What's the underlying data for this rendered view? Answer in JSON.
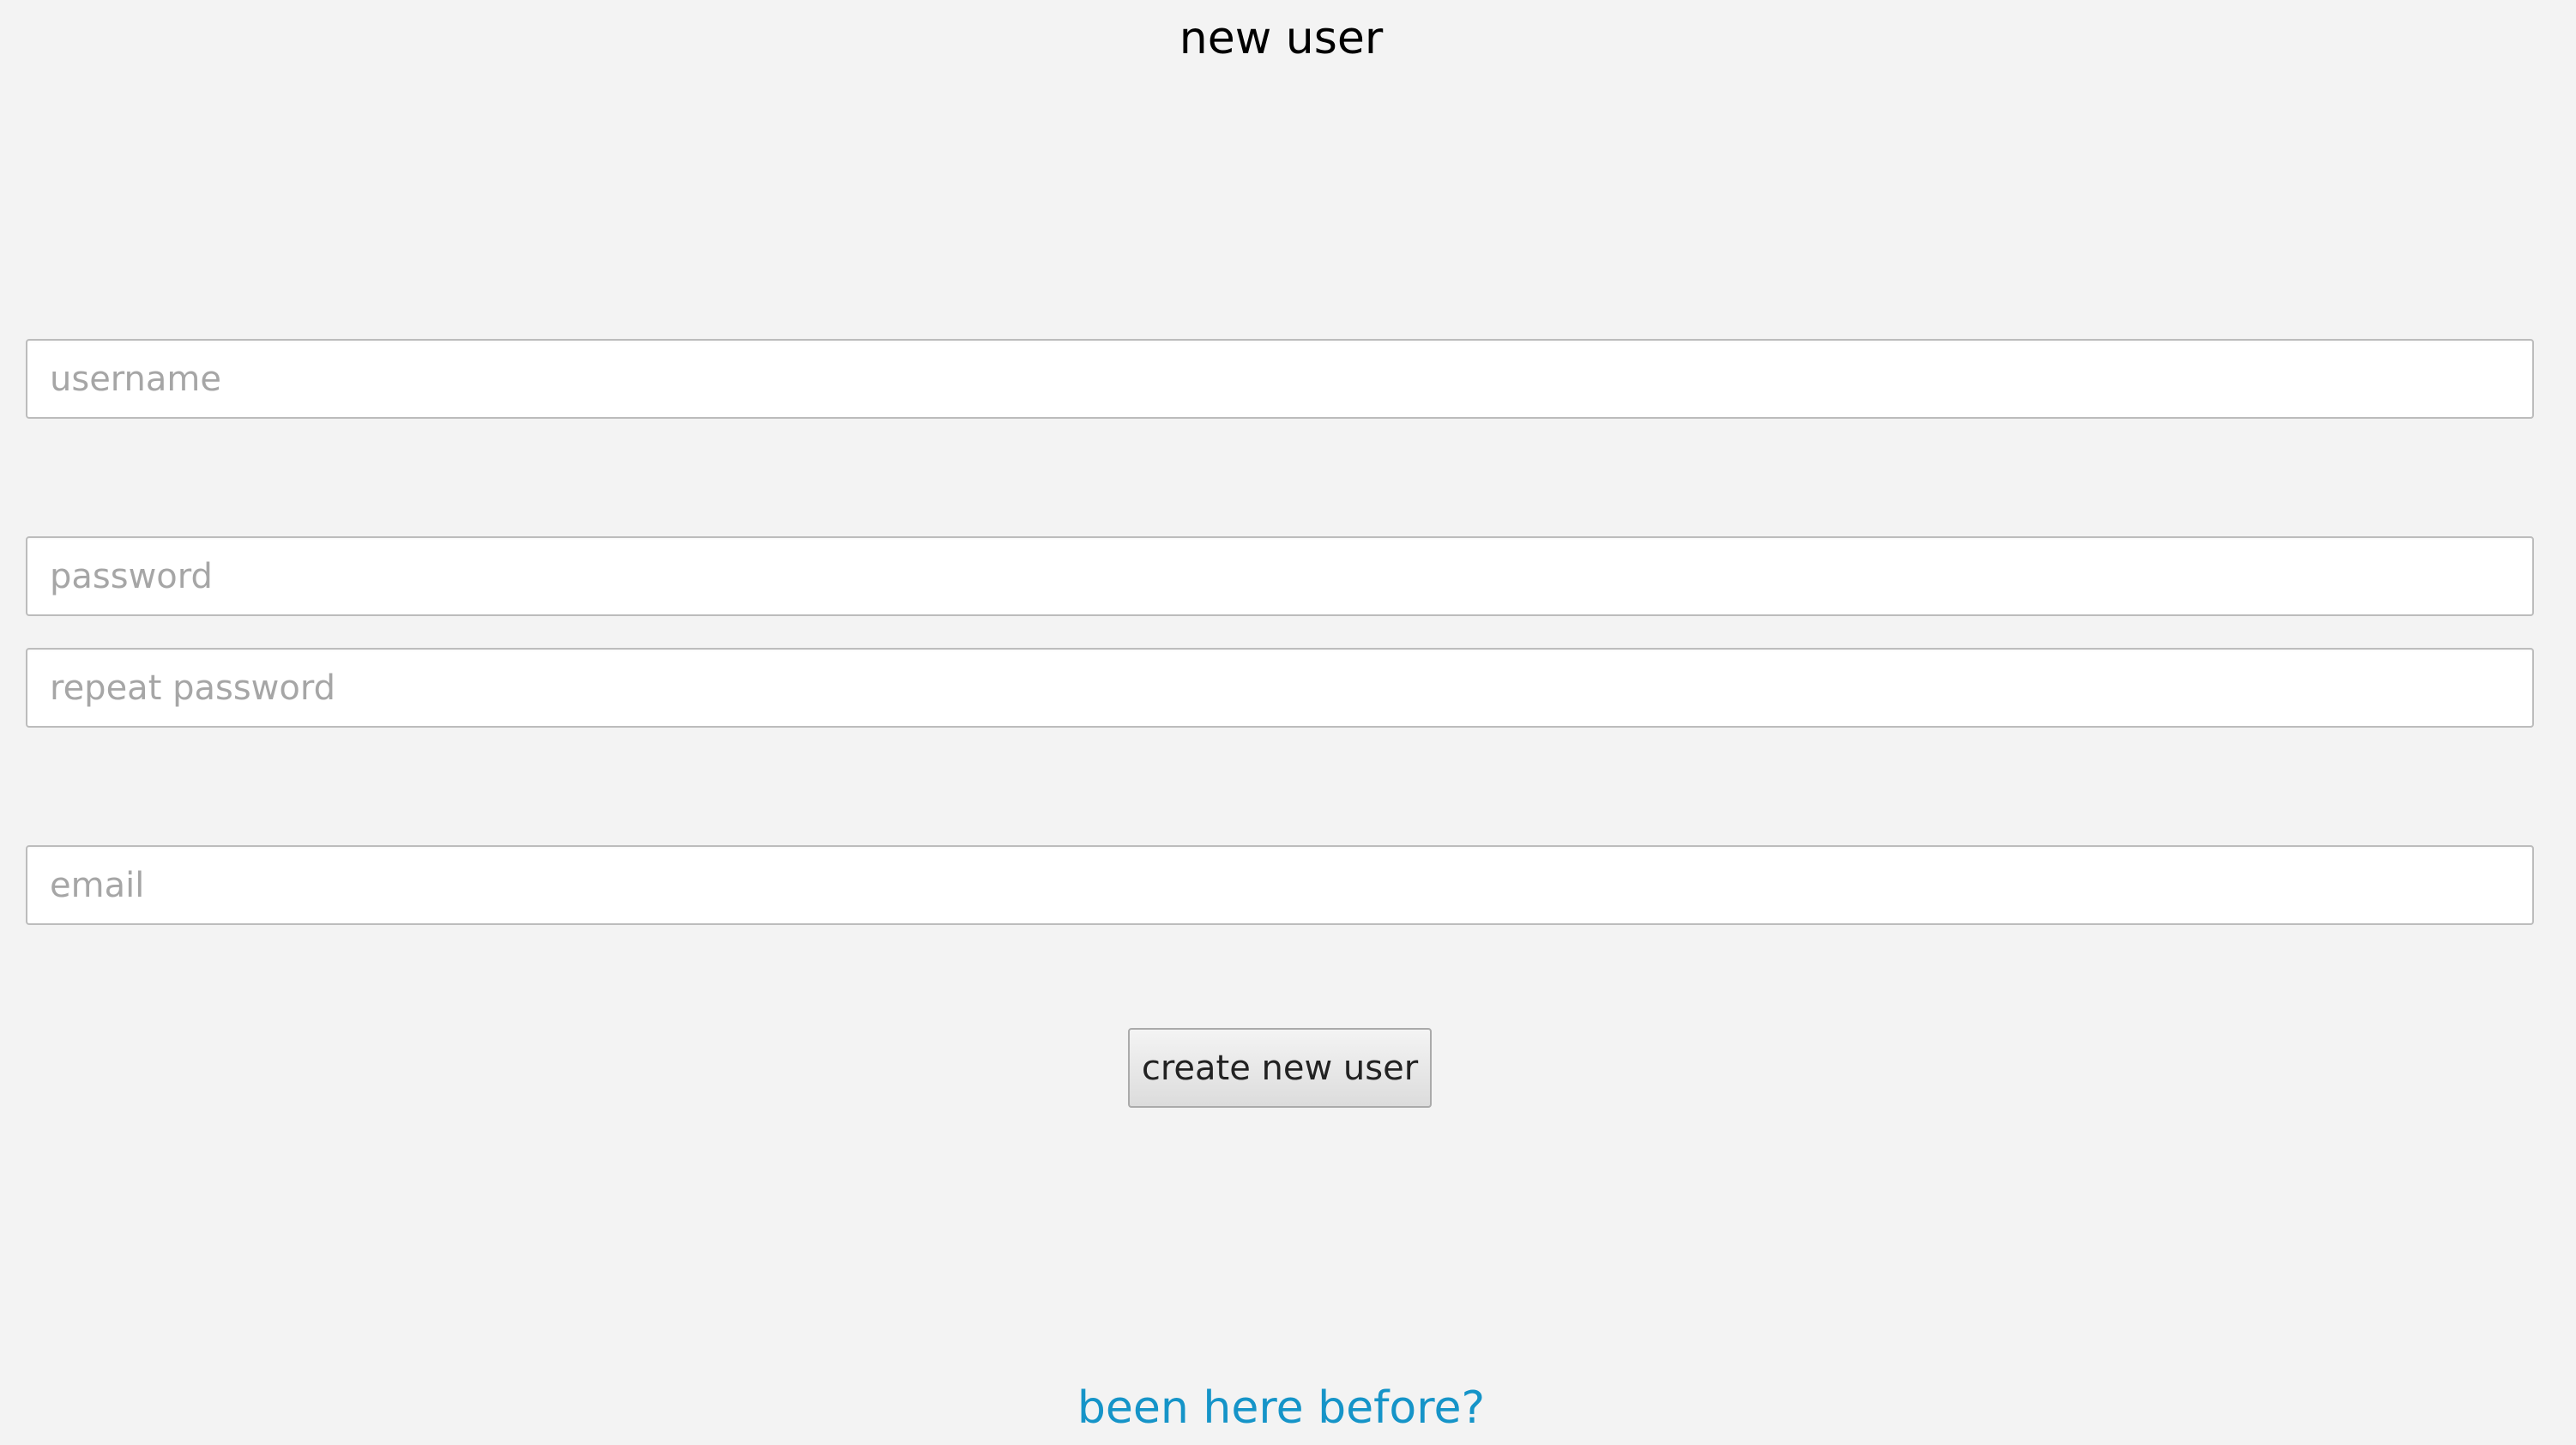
{
  "page": {
    "title": "new user"
  },
  "form": {
    "username_placeholder": "username",
    "username_value": "",
    "password_placeholder": "password",
    "password_value": "",
    "repeat_password_placeholder": "repeat password",
    "repeat_password_value": "",
    "email_placeholder": "email",
    "email_value": "",
    "submit_label": "create new user"
  },
  "footer": {
    "login_link": "been here before?"
  },
  "colors": {
    "background": "#f3f3f3",
    "link": "#1594c8",
    "field_border": "#bcbcbc",
    "placeholder": "#a6a6a6"
  }
}
